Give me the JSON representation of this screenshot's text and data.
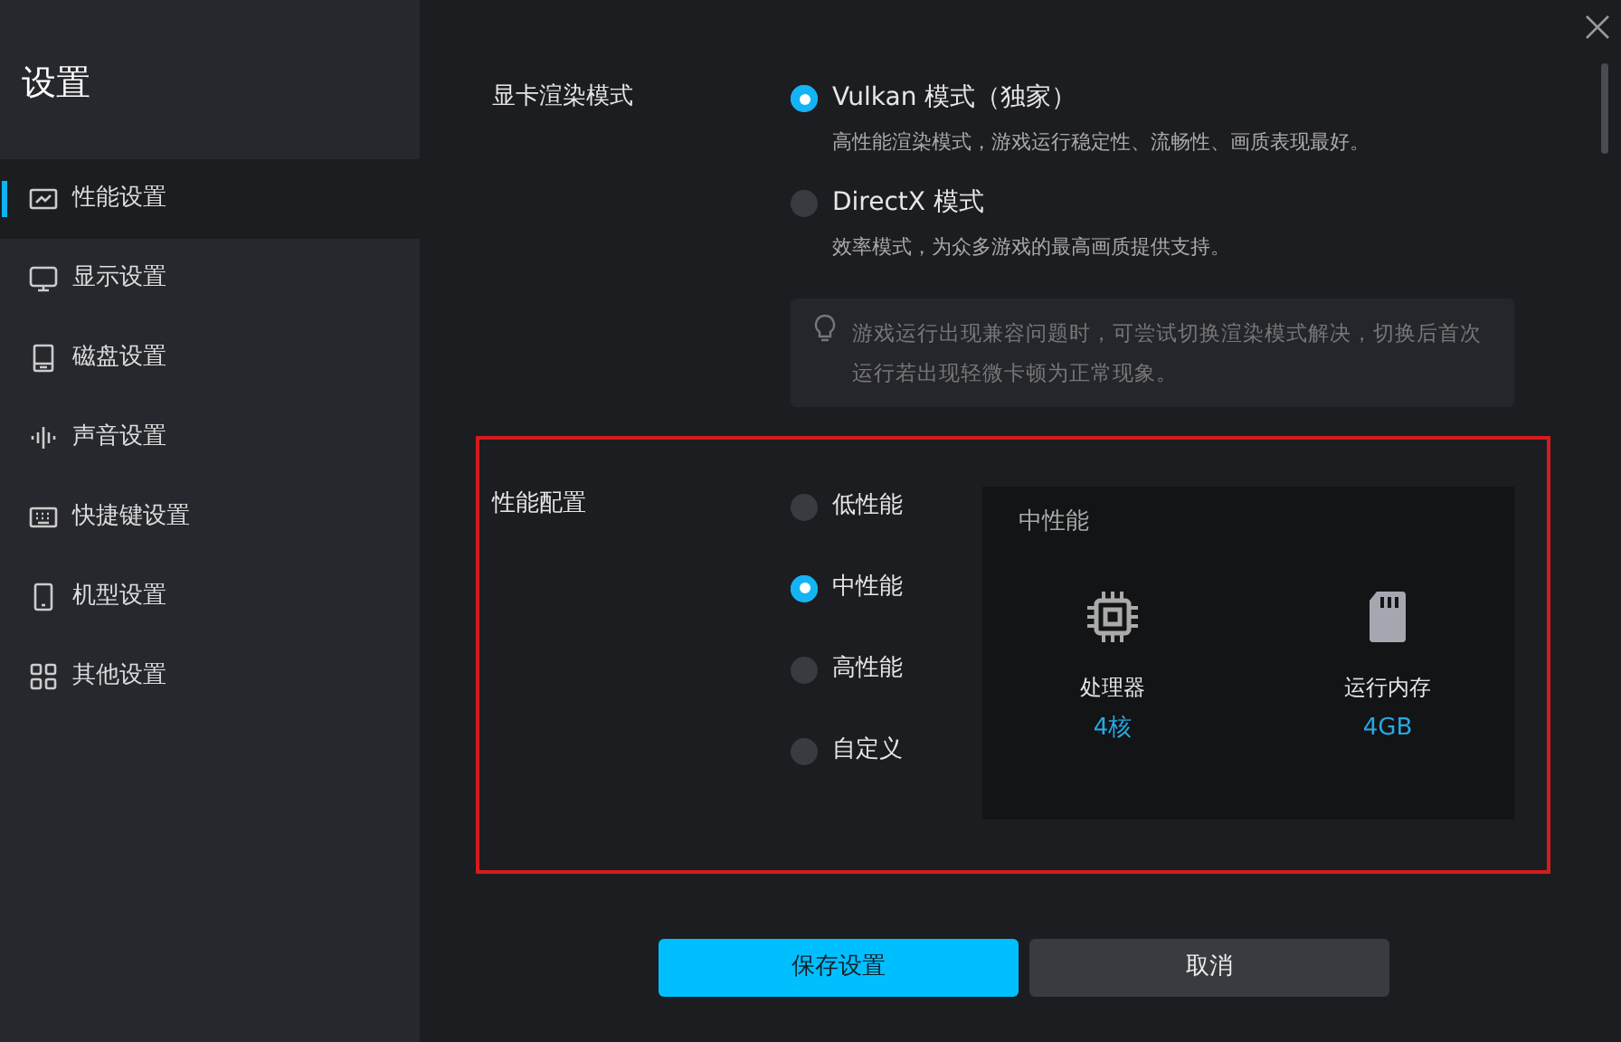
{
  "sidebar": {
    "title": "设置",
    "items": [
      {
        "label": "性能设置",
        "kind": "chart",
        "selected": true
      },
      {
        "label": "显示设置",
        "kind": "monitor",
        "selected": false
      },
      {
        "label": "磁盘设置",
        "kind": "disk",
        "selected": false
      },
      {
        "label": "声音设置",
        "kind": "sound",
        "selected": false
      },
      {
        "label": "快捷键设置",
        "kind": "keyboard",
        "selected": false
      },
      {
        "label": "机型设置",
        "kind": "phone",
        "selected": false
      },
      {
        "label": "其他设置",
        "kind": "grid",
        "selected": false
      }
    ]
  },
  "render_mode": {
    "label": "显卡渲染模式",
    "options": [
      {
        "label": "Vulkan 模式（独家）",
        "description": "高性能渲染模式，游戏运行稳定性、流畅性、画质表现最好。",
        "selected": true
      },
      {
        "label": "DirectX 模式",
        "description": "效率模式，为众多游戏的最高画质提供支持。",
        "selected": false
      }
    ],
    "tip": "游戏运行出现兼容问题时，可尝试切换渲染模式解决，切换后首次运行若出现轻微卡顿为正常现象。"
  },
  "performance": {
    "label": "性能配置",
    "highlighted": true,
    "options": [
      {
        "label": "低性能",
        "selected": false
      },
      {
        "label": "中性能",
        "selected": true
      },
      {
        "label": "高性能",
        "selected": false
      },
      {
        "label": "自定义",
        "selected": false
      }
    ],
    "card": {
      "title": "中性能",
      "specs": [
        {
          "kind": "cpu",
          "label": "处理器",
          "value": "4核"
        },
        {
          "kind": "memory",
          "label": "运行内存",
          "value": "4GB"
        }
      ]
    }
  },
  "buttons": [
    {
      "label": "保存设置",
      "kind": "primary"
    },
    {
      "label": "取消",
      "kind": "secondary"
    }
  ]
}
